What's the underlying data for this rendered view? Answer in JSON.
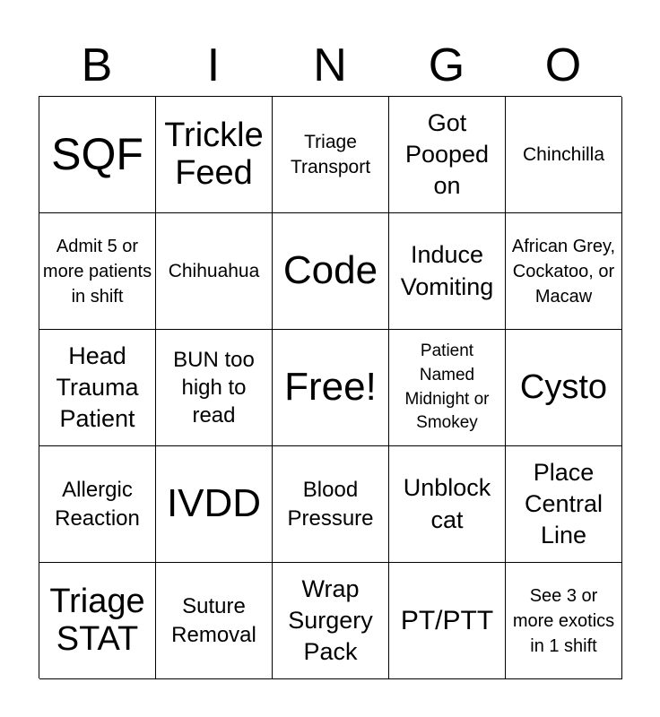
{
  "header": {
    "letters": [
      "B",
      "I",
      "N",
      "G",
      "O"
    ]
  },
  "board": {
    "rows": [
      [
        "SQF",
        "Trickle Feed",
        "Triage Transport",
        "Got Pooped on",
        "Chinchilla"
      ],
      [
        "Admit 5 or more patients in shift",
        "Chihuahua",
        "Code",
        "Induce Vomiting",
        "African Grey, Cockatoo, or Macaw"
      ],
      [
        "Head Trauma Patient",
        "BUN too high to read",
        "Free!",
        "Patient Named Midnight or Smokey",
        "Cysto"
      ],
      [
        "Allergic Reaction",
        "IVDD",
        "Blood Pressure",
        "Unblock cat",
        "Place Central Line"
      ],
      [
        "Triage STAT",
        "Suture Removal",
        "Wrap Surgery Pack",
        "PT/PTT",
        "See 3 or more exotics in 1 shift"
      ]
    ]
  }
}
